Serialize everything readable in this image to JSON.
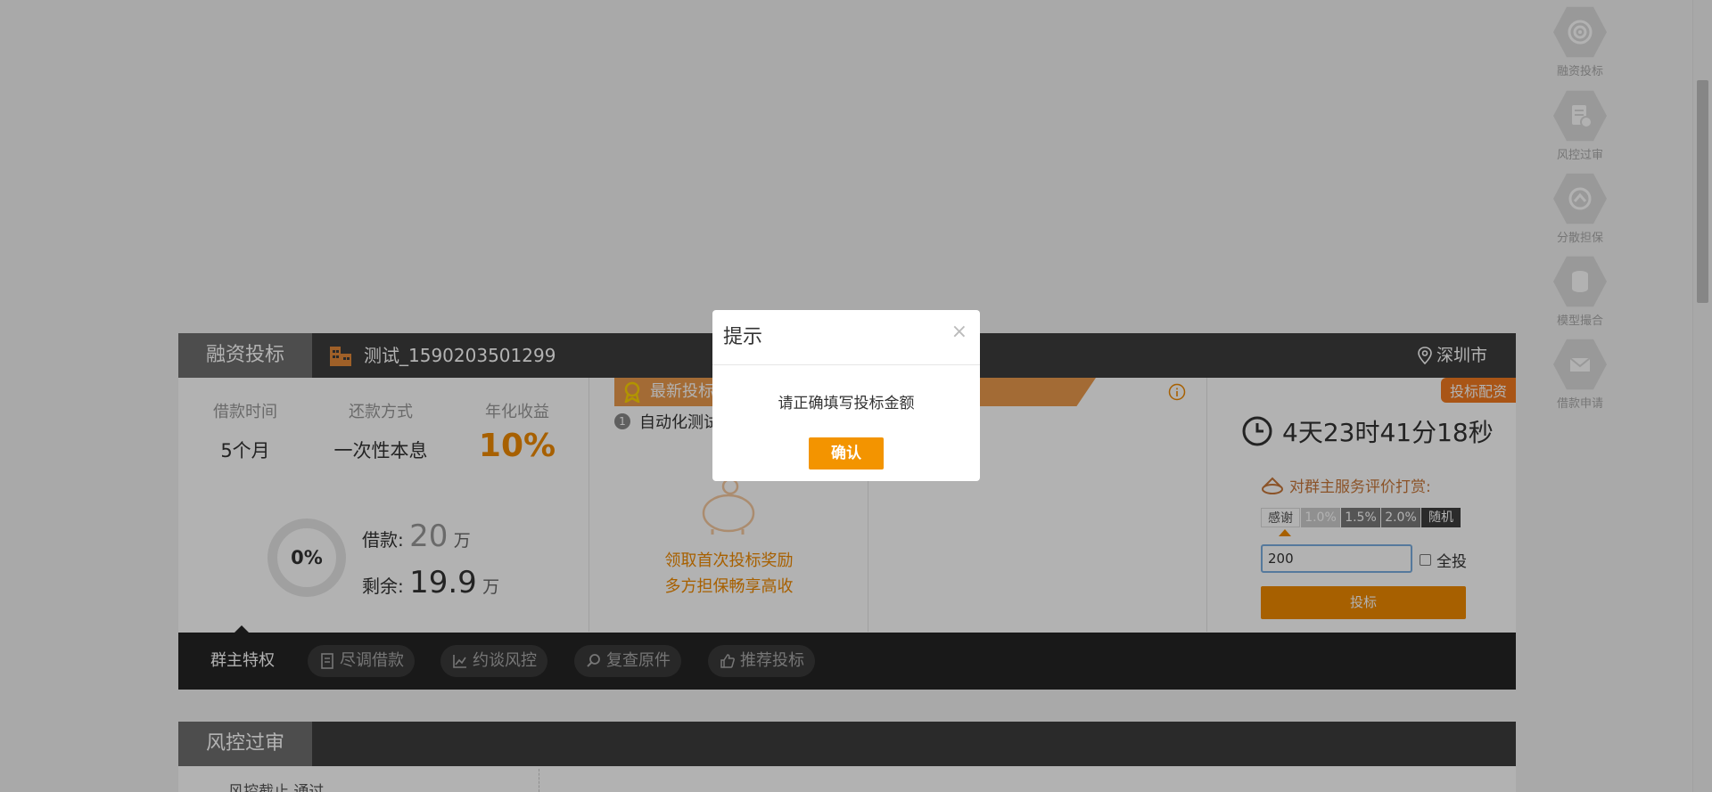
{
  "sidenav": {
    "items": [
      {
        "label": "融资投标",
        "icon": "target-icon"
      },
      {
        "label": "风控过审",
        "icon": "document-check-icon"
      },
      {
        "label": "分散担保",
        "icon": "share-icon"
      },
      {
        "label": "模型撮合",
        "icon": "database-icon"
      },
      {
        "label": "借款申请",
        "icon": "envelope-icon"
      }
    ]
  },
  "card": {
    "tab_label": "融资投标",
    "project_name": "测试_1590203501299",
    "city": "深圳市",
    "stats": {
      "term_label": "借款时间",
      "term_value": "5个月",
      "repay_label": "还款方式",
      "repay_value": "一次性本息",
      "yield_label": "年化收益",
      "yield_value": "10%"
    },
    "progress_text": "0%",
    "loan_label": "借款:",
    "loan_value": "20",
    "loan_unit": "万",
    "remain_label": "剩余:",
    "remain_value": "19.9",
    "remain_unit": "万",
    "ribbon_text": "最新投标",
    "auto_num": "1",
    "auto_text": "自动化测试",
    "reward_line1": "领取首次投标奖励",
    "reward_line2": "多方担保畅享高收",
    "badge": "投标配资",
    "countdown": "4天23时41分18秒",
    "rate_title": "对群主服务评价打赏:",
    "rate_options": [
      "感谢",
      "1.0%",
      "1.5%",
      "2.0%",
      "随机"
    ],
    "amount_value": "200",
    "allin_label": "全投",
    "bid_button": "投标",
    "footer": {
      "active": "群主特权",
      "pills": [
        "尽调借款",
        "约谈风控",
        "复查原件",
        "推荐投标"
      ]
    }
  },
  "card2": {
    "tab_label": "风控过审",
    "text": "风控截止  通过"
  },
  "modal": {
    "title": "提示",
    "close": "×",
    "message": "请正确填写投标金额",
    "confirm": "确认"
  },
  "colors": {
    "accent": "#f08a00",
    "header": "#3d3d3d",
    "tab": "#6f6f6f",
    "footer": "#242424"
  }
}
